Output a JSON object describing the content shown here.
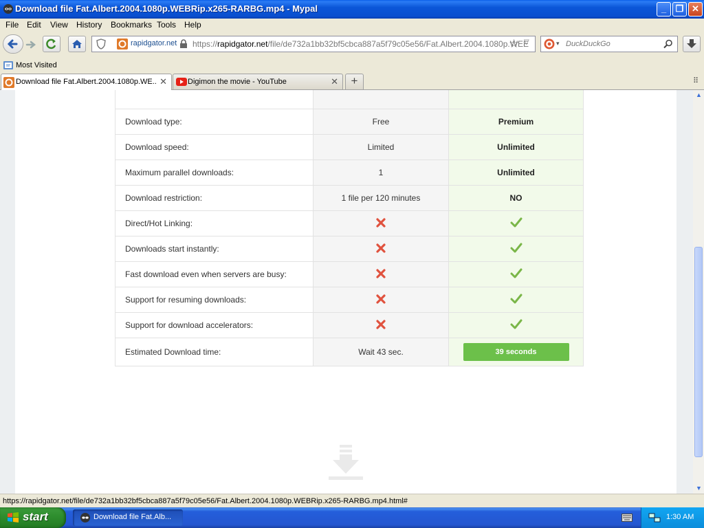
{
  "window": {
    "title": "Download file Fat.Albert.2004.1080p.WEBRip.x265-RARBG.mp4 - Mypal",
    "controls": {
      "minimize": "_",
      "maximize": "❐",
      "close": "✕"
    }
  },
  "menu": [
    "File",
    "Edit",
    "View",
    "History",
    "Bookmarks",
    "Tools",
    "Help"
  ],
  "navigation": {
    "site_identity": "rapidgator.net",
    "url_scheme": "https://",
    "url_host": "rapidgator.net",
    "url_path": "/file/de732a1bb32bf5cbca887a5f79c05e56/Fat.Albert.2004.1080p.WEE",
    "search_placeholder": "DuckDuckGo"
  },
  "bookmarks": {
    "most_visited": "Most Visited"
  },
  "tabs": [
    {
      "label": "Download file Fat.Albert.2004.1080p.WE...",
      "active": true
    },
    {
      "label": "Digimon the movie - YouTube",
      "active": false
    }
  ],
  "comparison": {
    "rows": [
      {
        "feature": "Download type:",
        "free": "Free",
        "premium": "Premium"
      },
      {
        "feature": "Download speed:",
        "free": "Limited",
        "premium": "Unlimited"
      },
      {
        "feature": "Maximum parallel downloads:",
        "free": "1",
        "premium": "Unlimited"
      },
      {
        "feature": "Download restriction:",
        "free": "1 file per 120 minutes",
        "premium": "NO"
      },
      {
        "feature": "Direct/Hot Linking:",
        "free": false,
        "premium": true
      },
      {
        "feature": "Downloads start instantly:",
        "free": false,
        "premium": true
      },
      {
        "feature": "Fast download even when servers are busy:",
        "free": false,
        "premium": true
      },
      {
        "feature": "Support for resuming downloads:",
        "free": false,
        "premium": true
      },
      {
        "feature": "Support for download accelerators:",
        "free": false,
        "premium": true
      }
    ],
    "estimated": {
      "feature": "Estimated Download time:",
      "free": "Wait 43 sec.",
      "premium": "39 seconds"
    }
  },
  "status_bar": {
    "text": "https://rapidgator.net/file/de732a1bb32bf5cbca887a5f79c05e56/Fat.Albert.2004.1080p.WEBRip.x265-RARBG.mp4.html#"
  },
  "taskbar": {
    "start": "start",
    "window_button": "Download file Fat.Alb...",
    "clock": "1:30 AM"
  },
  "colors": {
    "premium_green": "#6cc04a",
    "cross_red": "#e0523e",
    "check_green": "#7ab648"
  }
}
